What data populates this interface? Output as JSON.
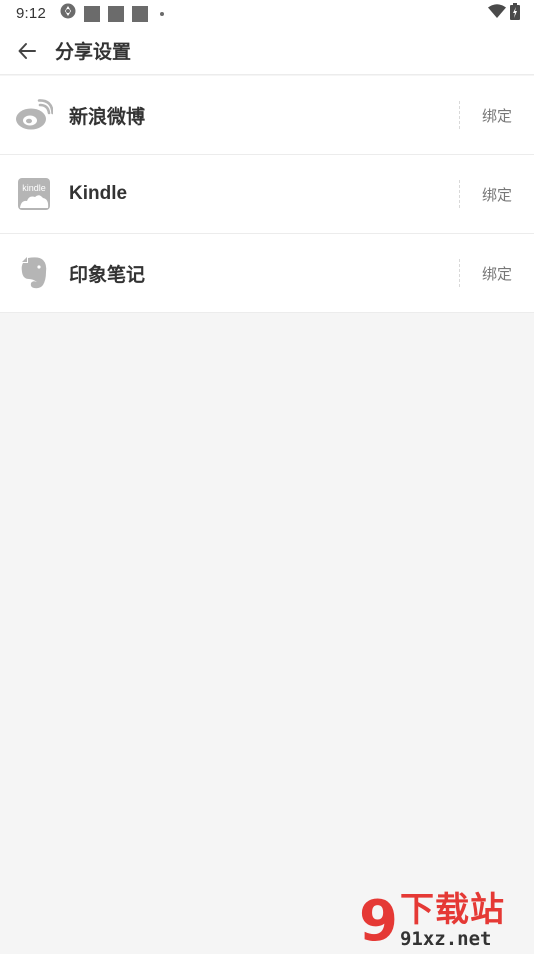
{
  "status_bar": {
    "time": "9:12",
    "notification_icons": [
      "aperture-icon",
      "app-square-icon",
      "app-square-icon",
      "app-square-icon",
      "dot-icon"
    ],
    "right_icons": [
      "wifi-icon",
      "battery-icon"
    ]
  },
  "header": {
    "title": "分享设置",
    "back_icon": "back-arrow-icon"
  },
  "services": [
    {
      "name": "新浪微博",
      "icon": "weibo-icon",
      "action": "绑定"
    },
    {
      "name": "Kindle",
      "icon": "kindle-icon",
      "icon_text": "kindle",
      "action": "绑定"
    },
    {
      "name": "印象笔记",
      "icon": "evernote-icon",
      "action": "绑定"
    }
  ],
  "watermark": {
    "number": "9",
    "text": "下载站",
    "url": "91xz.net"
  },
  "colors": {
    "background": "#f5f5f5",
    "surface": "#ffffff",
    "icon_gray": "#b5b5b5",
    "watermark_red": "#e53935"
  }
}
